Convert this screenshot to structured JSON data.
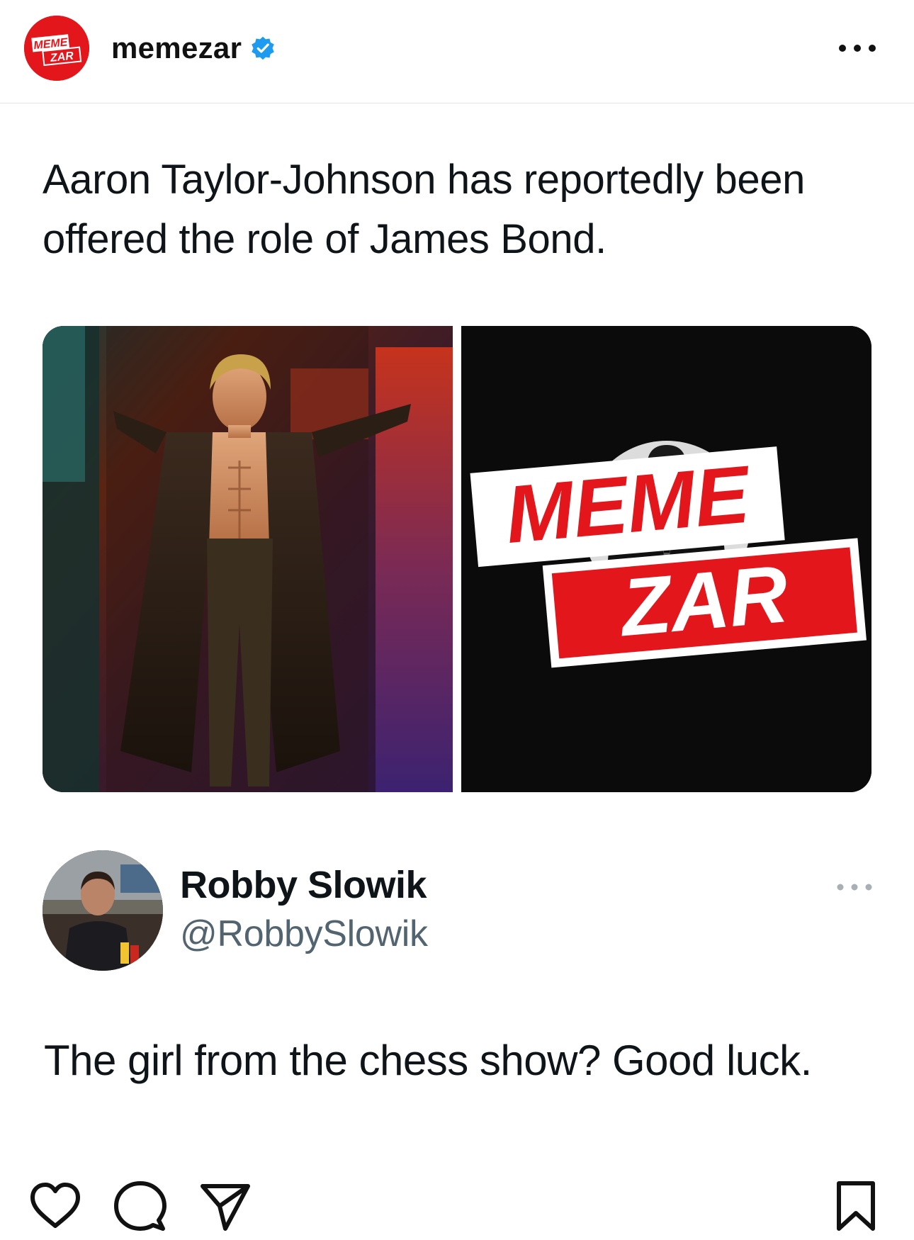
{
  "header": {
    "avatar_logo_line1": "MEME",
    "avatar_logo_line2": "ZAR",
    "username": "memezar",
    "verified": true,
    "more_icon": "more-horizontal-icon"
  },
  "post": {
    "headline": "Aaron Taylor-Johnson has reportedly been offered the role of James Bond.",
    "media": [
      {
        "name": "photo-actor",
        "description_icon": "photo"
      },
      {
        "name": "photo-bond-silhouette",
        "watermark_line1": "MEME",
        "watermark_line2": "ZAR"
      }
    ]
  },
  "reply": {
    "display_name": "Robby Slowik",
    "handle": "@RobbySlowik",
    "text": "The girl from the chess show? Good luck.",
    "more_icon": "more-horizontal-icon"
  },
  "actions": {
    "like_icon": "heart-icon",
    "comment_icon": "comment-icon",
    "share_icon": "send-icon",
    "save_icon": "bookmark-icon"
  },
  "colors": {
    "brand_red": "#e3161c",
    "verified_blue": "#1d9bf0",
    "text_primary": "#0f1419",
    "text_secondary": "#536471"
  }
}
